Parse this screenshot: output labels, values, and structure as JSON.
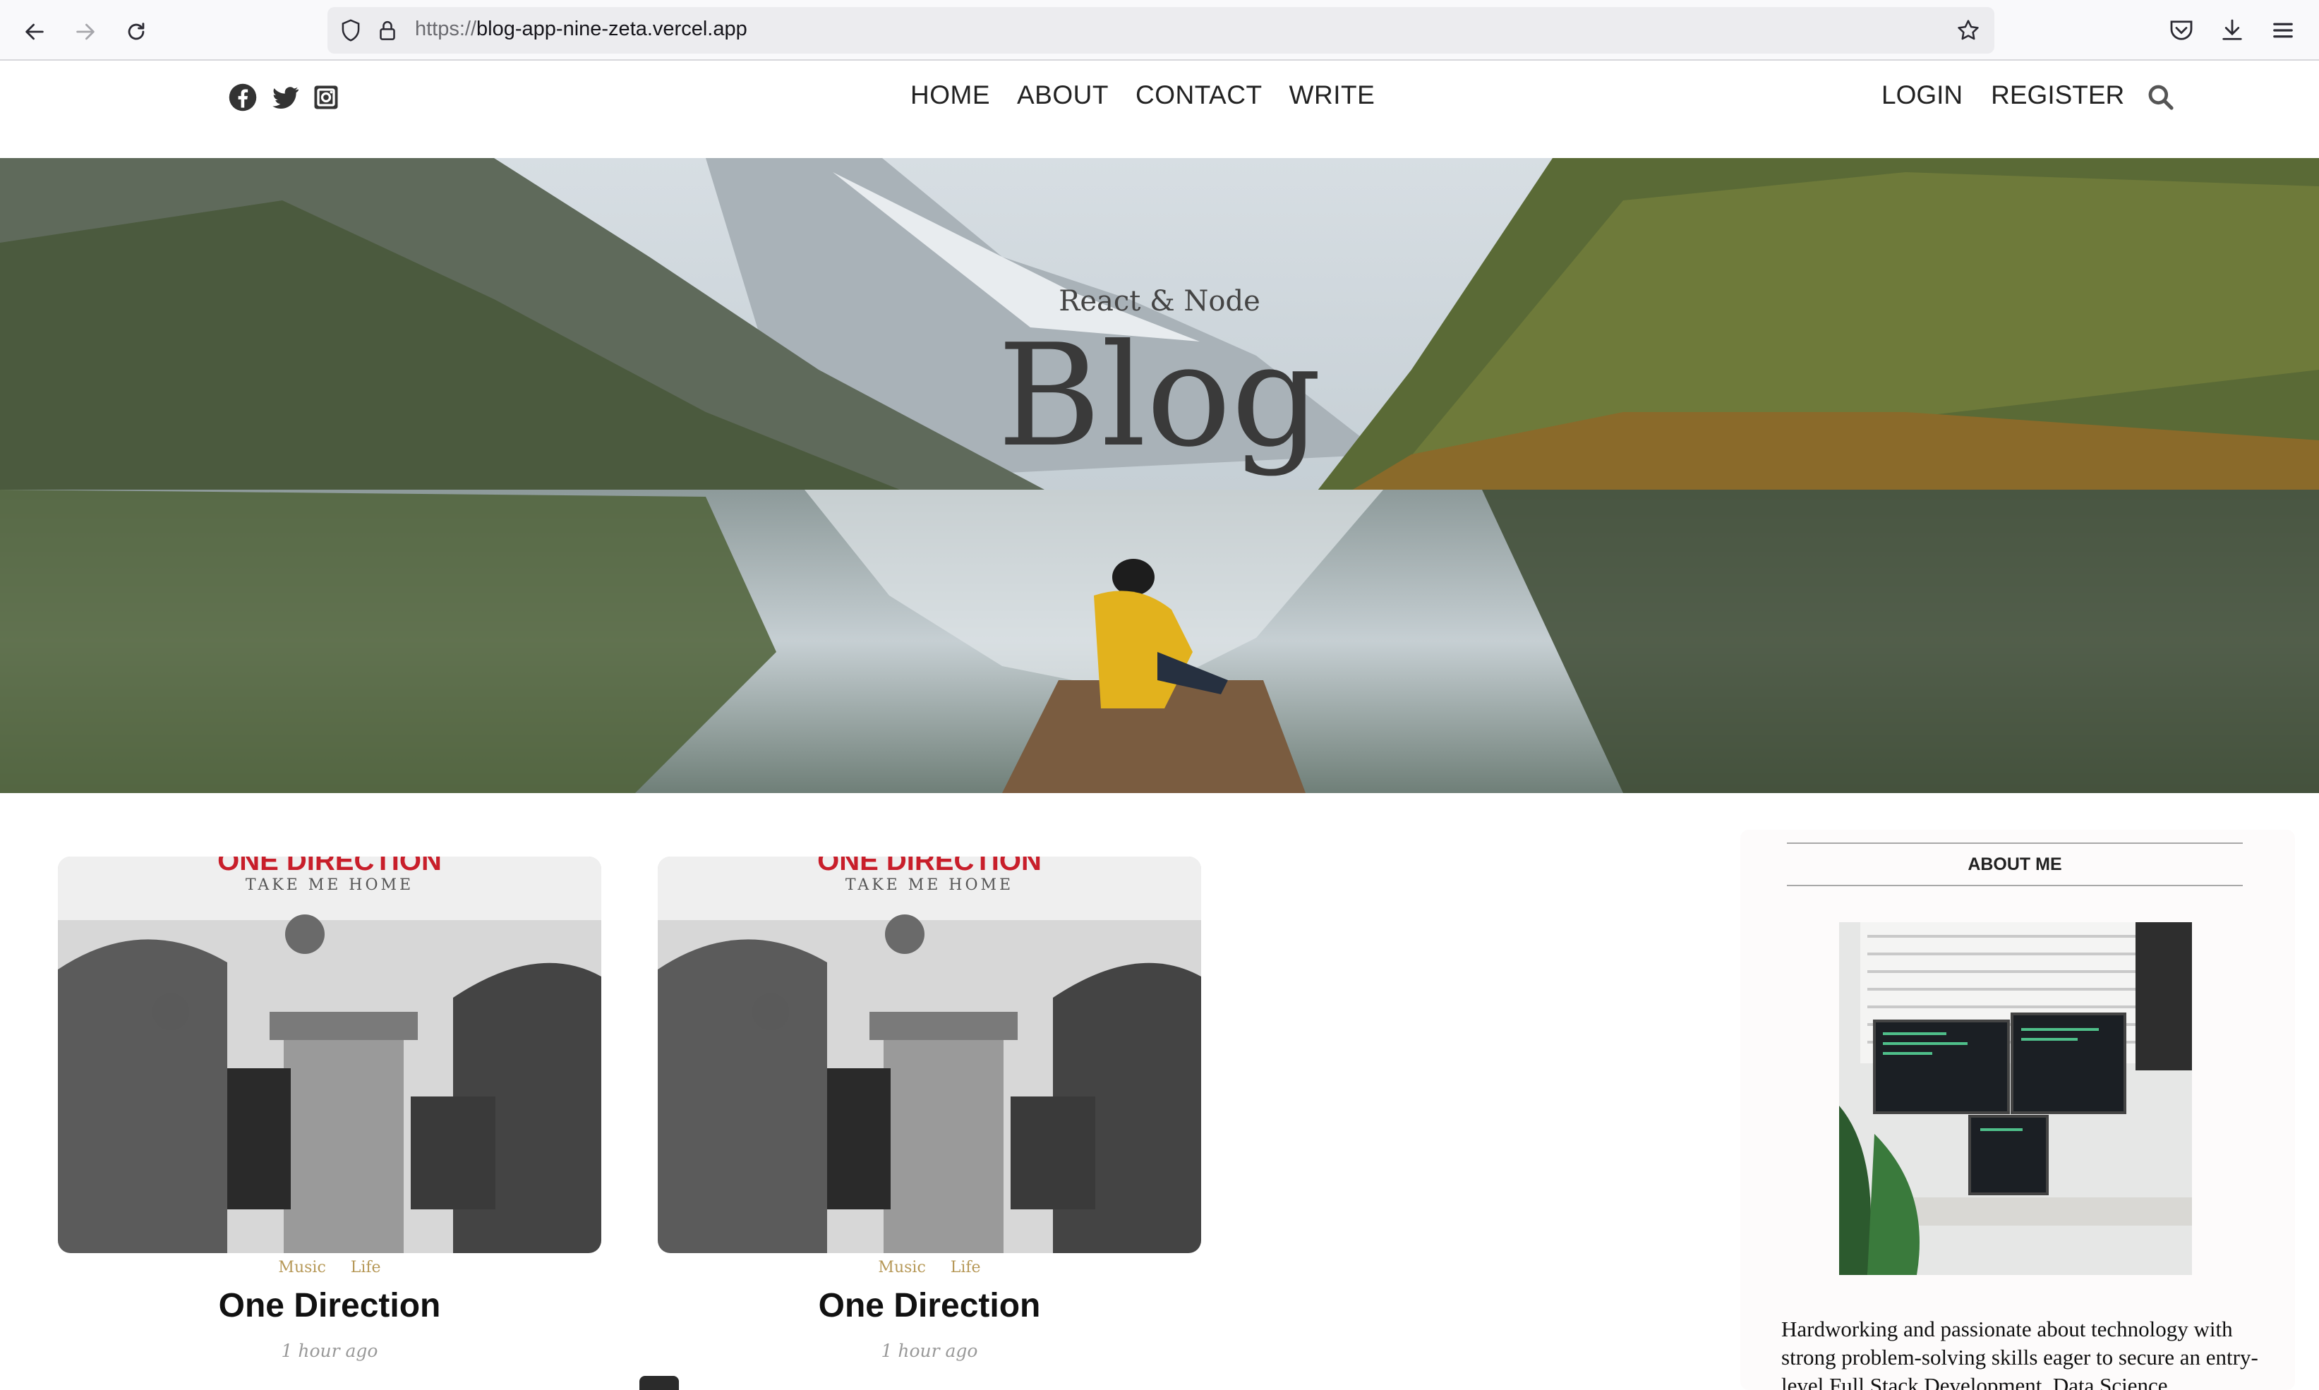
{
  "browser": {
    "url_protocol": "https://",
    "url_host": "blog-app-nine-zeta.vercel.app"
  },
  "topbar": {
    "nav": [
      "HOME",
      "ABOUT",
      "CONTACT",
      "WRITE"
    ],
    "auth": [
      "LOGIN",
      "REGISTER"
    ]
  },
  "header": {
    "subtitle": "React & Node",
    "title": "Blog"
  },
  "posts": [
    {
      "cover_text_top": "ONE DIRECTION",
      "cover_text": "TAKE ME HOME",
      "categories": [
        "Music",
        "Life"
      ],
      "title": "One Direction",
      "time": "1 hour ago"
    },
    {
      "cover_text_top": "ONE DIRECTION",
      "cover_text": "TAKE ME HOME",
      "categories": [
        "Music",
        "Life"
      ],
      "title": "One Direction",
      "time": "1 hour ago"
    }
  ],
  "sidebar": {
    "title": "ABOUT ME",
    "text": "Hardworking and passionate about technology with strong problem-solving skills eager to secure an entry-level Full Stack Development, Data Science"
  },
  "colors": {
    "category": "#b69857",
    "date": "#999999",
    "cover_red": "#c81e2a"
  },
  "icons": [
    "back-icon",
    "forward-icon",
    "reload-icon",
    "shield-icon",
    "lock-icon",
    "star-icon",
    "pocket-icon",
    "download-icon",
    "menu-icon",
    "facebook-icon",
    "twitter-icon",
    "instagram-icon",
    "search-icon"
  ]
}
